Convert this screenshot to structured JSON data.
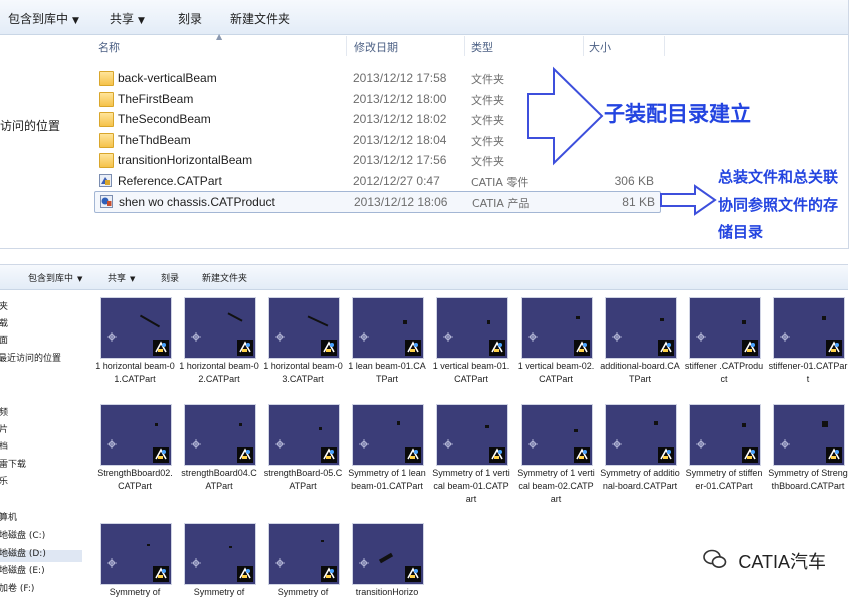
{
  "top_explorer": {
    "toolbar": {
      "include_in_library": "包含到库中",
      "share": "共享",
      "burn": "刻录",
      "new_folder": "新建文件夹"
    },
    "side_labels": [
      "访问的位置"
    ],
    "columns": {
      "name": "名称",
      "modified": "修改日期",
      "type": "类型",
      "size": "大小"
    },
    "files": [
      {
        "name": "back-verticalBeam",
        "date": "2013/12/12 17:58",
        "type": "文件夹",
        "size": "",
        "icon": "folder-icon"
      },
      {
        "name": "TheFirstBeam",
        "date": "2013/12/12 18:00",
        "type": "文件夹",
        "size": "",
        "icon": "folder-icon"
      },
      {
        "name": "TheSecondBeam",
        "date": "2013/12/12 18:02",
        "type": "文件夹",
        "size": "",
        "icon": "folder-icon"
      },
      {
        "name": "TheThdBeam",
        "date": "2013/12/12 18:04",
        "type": "文件夹",
        "size": "",
        "icon": "folder-icon"
      },
      {
        "name": "transitionHorizontalBeam",
        "date": "2013/12/12 17:56",
        "type": "文件夹",
        "size": "",
        "icon": "folder-icon"
      },
      {
        "name": "Reference.CATPart",
        "date": "2012/12/27 0:47",
        "type": "CATIA 零件",
        "size": "306 KB",
        "icon": "catpart-icon"
      },
      {
        "name": "shen wo  chassis.CATProduct",
        "date": "2013/12/12 18:06",
        "type": "CATIA 产品",
        "size": "81 KB",
        "icon": "catproduct-icon"
      }
    ],
    "annotations": {
      "subassembly": "子装配目录建立",
      "assembly_line1": "总装文件和总关联",
      "assembly_line2": "协同参照文件的存",
      "assembly_line3": "储目录"
    }
  },
  "bottom_explorer": {
    "toolbar": {
      "include_in_library": "包含到库中",
      "share": "共享",
      "burn": "刻录",
      "new_folder": "新建文件夹"
    },
    "nav": [
      "载夹",
      "下载",
      "桌面",
      "最近访问的位置",
      "视频",
      "图片",
      "文档",
      "迅雷下载",
      "音乐",
      "计算机",
      "本地磁盘 (C:)",
      "本地磁盘 (D:)",
      "本地磁盘 (E:)",
      "新加卷 (F:)"
    ],
    "tiles": [
      "1 horizontal beam-01.CATPart",
      "1 horizontal beam-02.CATPart",
      "1 horizontal beam-03.CATPart",
      "1 lean beam-01.CATPart",
      "1 vertical beam-01.CATPart",
      "1 vertical beam-02.CATPart",
      "additional-board.CATPart",
      "stiffener .CATProduct",
      "stiffener-01.CATPart",
      "StrengthBboard02.CATPart",
      "strengthBoard04.CATPart",
      "strengthBoard-05.CATPart",
      "Symmetry of 1 lean beam-01.CATPart",
      "Symmetry of 1 vertical beam-01.CATPart",
      "Symmetry of 1 vertical beam-02.CATPart",
      "Symmetry of additional-board.CATPart",
      "Symmetry of stiffener-01.CATPart",
      "Symmetry of StrengthBboard.CATPart",
      "Symmetry of",
      "Symmetry of",
      "Symmetry of",
      "transitionHorizo"
    ]
  },
  "watermark": "CATIA汽车",
  "colors": {
    "annotation_blue": "#2344e0",
    "thumb_bg": "#3b3d78",
    "toolbar": "#e3ecf7"
  }
}
